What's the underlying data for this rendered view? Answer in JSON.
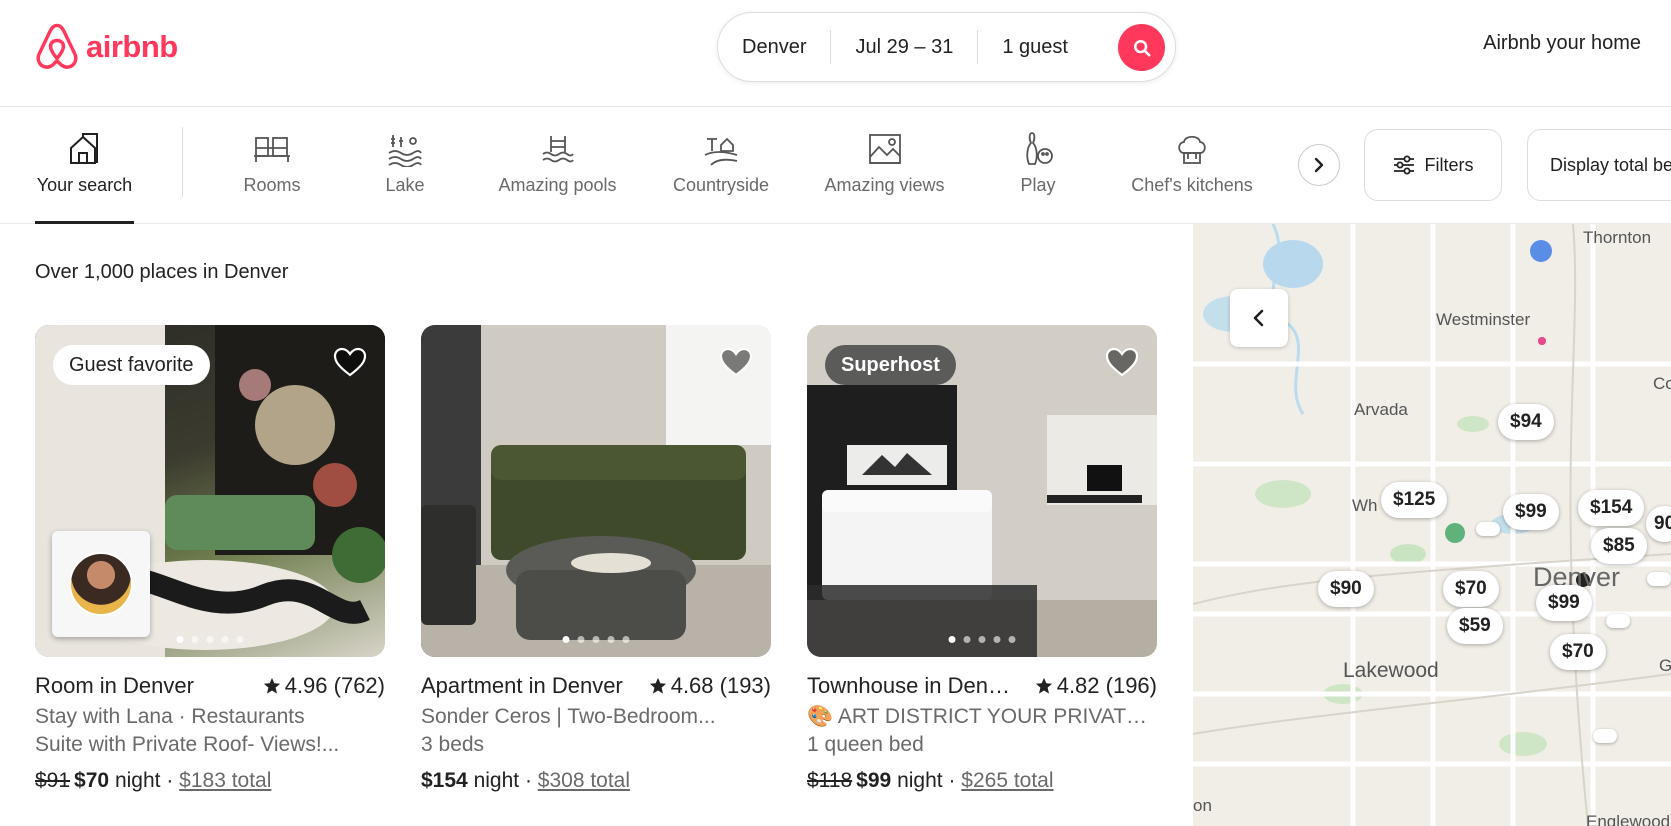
{
  "header": {
    "logo_text": "airbnb",
    "search": {
      "location": "Denver",
      "dates": "Jul 29 – 31",
      "guests": "1 guest"
    },
    "host_link": "Airbnb your home"
  },
  "categories": [
    {
      "label": "Your search",
      "icon": "home-icon",
      "active": true
    },
    {
      "label": "Rooms",
      "icon": "bed-icon"
    },
    {
      "label": "Lake",
      "icon": "lake-icon"
    },
    {
      "label": "Amazing pools",
      "icon": "pool-icon"
    },
    {
      "label": "Countryside",
      "icon": "countryside-icon"
    },
    {
      "label": "Amazing views",
      "icon": "views-icon"
    },
    {
      "label": "Play",
      "icon": "bowling-icon"
    },
    {
      "label": "Chef's kitchens",
      "icon": "chef-hat-icon"
    }
  ],
  "toolbar": {
    "filters_label": "Filters",
    "display_total_label": "Display total before taxes"
  },
  "results": {
    "title": "Over 1,000 places in Denver",
    "listings": [
      {
        "badge": "Guest favorite",
        "title": "Room in Denver",
        "rating": "4.96 (762)",
        "subtitle": "Stay with Lana · Restaurants",
        "subtitle2": "Suite with Private Roof- Views!...",
        "old_price": "$91",
        "price": "$70",
        "night_label": "night",
        "total": "$183 total"
      },
      {
        "badge": "",
        "title": "Apartment in Denver",
        "rating": "4.68 (193)",
        "subtitle": "Sonder Ceros | Two-Bedroom...",
        "subtitle2": "3 beds",
        "old_price": "",
        "price": "$154",
        "night_label": "night",
        "total": "$308 total"
      },
      {
        "badge": "Superhost",
        "title": "Townhouse in Denver",
        "rating": "4.82 (196)",
        "subtitle": "🎨 ART DISTRICT YOUR PRIVATE...",
        "subtitle2": "1 queen bed",
        "old_price": "$118",
        "price": "$99",
        "night_label": "night",
        "total": "$265 total"
      }
    ]
  },
  "map": {
    "places": [
      "Thornton",
      "Westminster",
      "Arvada",
      "Wh",
      "Denver",
      "Lakewood",
      "Englewood",
      "Co",
      "G",
      "on"
    ],
    "pins": [
      "$94",
      "$125",
      "$99",
      "$154",
      "$85",
      "$90",
      "$70",
      "$59",
      "$99",
      "$70",
      "90"
    ]
  },
  "colors": {
    "brand": "#FF385C",
    "text": "#222222",
    "muted": "#6a6a6a"
  }
}
